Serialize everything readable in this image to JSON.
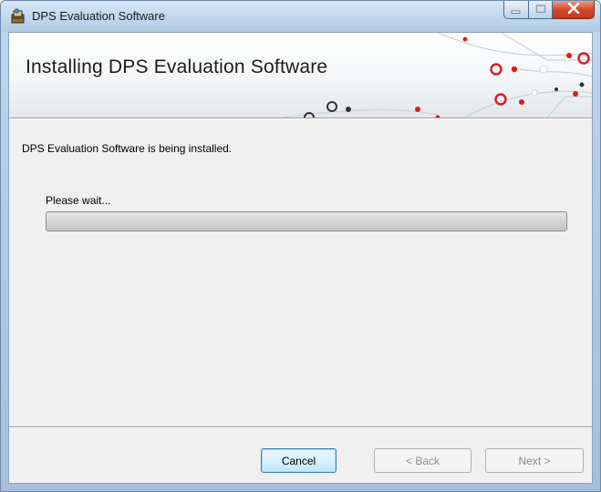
{
  "window": {
    "title": "DPS Evaluation Software"
  },
  "banner": {
    "title": "Installing DPS Evaluation Software"
  },
  "main": {
    "status_text": "DPS Evaluation Software is being installed.",
    "wait_text": "Please wait...",
    "progress_fraction": 0
  },
  "buttons": {
    "cancel_label": "Cancel",
    "back_label": "< Back",
    "next_label": "Next >"
  },
  "colors": {
    "accent_red": "#d81e1e",
    "titlebar_blue": "#c2d8ee",
    "close_red": "#d2472b"
  },
  "icons": [
    "installer-icon",
    "minimize-icon",
    "maximize-icon",
    "close-icon"
  ]
}
